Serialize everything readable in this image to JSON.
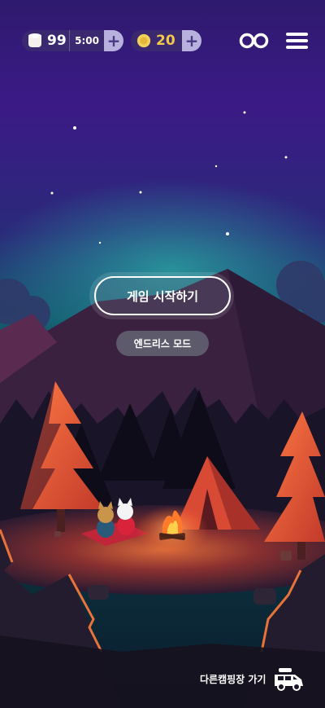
{
  "hud": {
    "marshmallow_count": "99",
    "timer": "5:00",
    "coin_count": "20",
    "plus_symbol": "+"
  },
  "icons": {
    "marshmallow": "marshmallow-icon",
    "coin": "coin-icon",
    "infinity": "infinity-icon",
    "menu": "hamburger-menu-icon",
    "car": "camper-car-icon"
  },
  "buttons": {
    "start_game": "게임 시작하기",
    "endless_mode": "엔드리스 모드",
    "other_campsite": "다른캠핑장 가기"
  },
  "colors": {
    "sky_top": "#3a1a8c",
    "sky_glow": "#1d8a8c",
    "tree_orange": "#e8553a",
    "tent": "#d94a34",
    "fire": "#ff7a2a",
    "coin_text": "#f2c94c"
  }
}
